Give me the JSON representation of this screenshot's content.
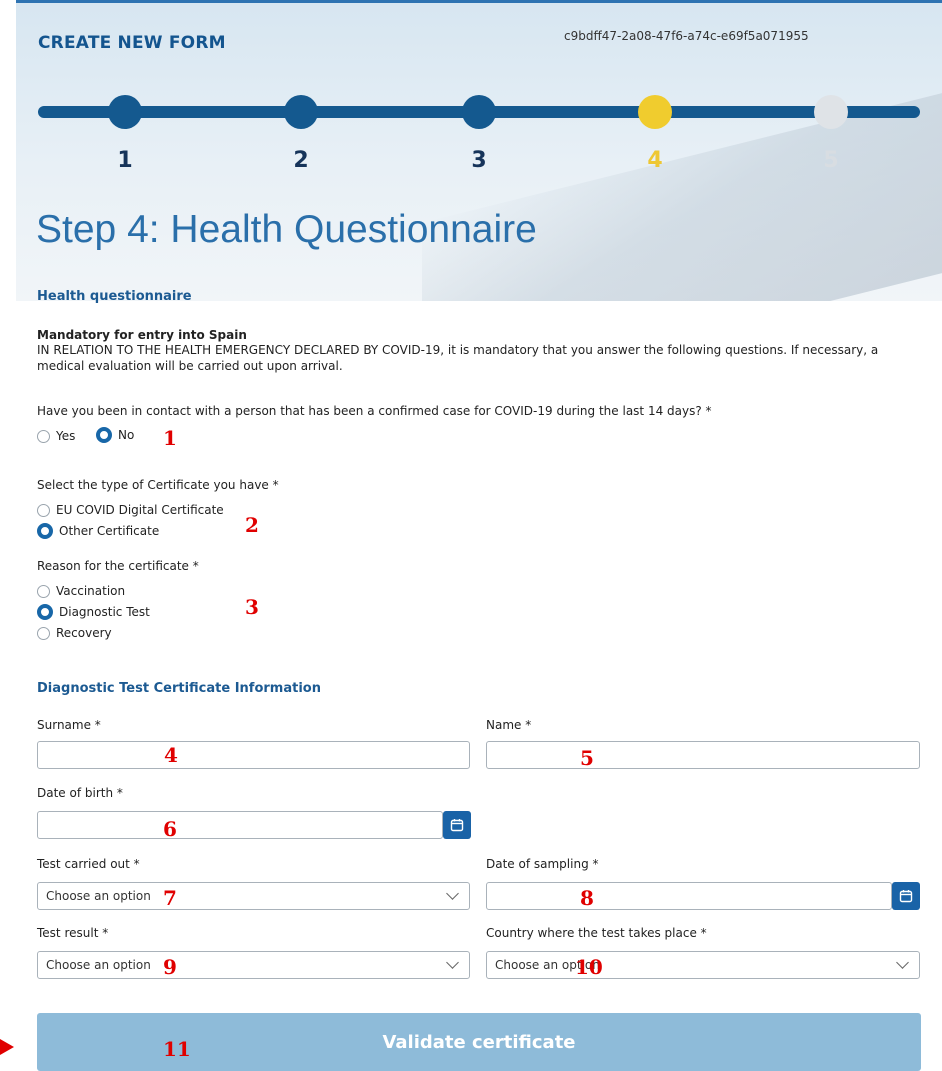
{
  "header": {
    "title": "CREATE NEW FORM",
    "form_id": "c9bdff47-2a08-47f6-a74c-e69f5a071955",
    "steps": [
      "1",
      "2",
      "3",
      "4",
      "5"
    ],
    "current_step": 4,
    "page_title": "Step 4: Health Questionnaire"
  },
  "questionnaire": {
    "section_title": "Health questionnaire",
    "mandatory_title": "Mandatory for entry into Spain",
    "intro_text": "IN RELATION TO THE HEALTH EMERGENCY DECLARED BY COVID-19, it is mandatory that you answer the following questions. If necessary, a medical evaluation will be carried out upon arrival.",
    "contact_question": "Have you been in contact with a person that has been a confirmed case for COVID-19 during the last 14 days? *",
    "contact_options": [
      "Yes",
      "No"
    ],
    "contact_selected": "No",
    "certificate_question": "Select the type of Certificate you have *",
    "certificate_options": [
      "EU COVID Digital Certificate",
      "Other Certificate"
    ],
    "certificate_selected": "Other Certificate",
    "reason_question": "Reason for the certificate *",
    "reason_options": [
      "Vaccination",
      "Diagnostic Test",
      "Recovery"
    ],
    "reason_selected": "Diagnostic Test"
  },
  "diagnostic": {
    "section_title": "Diagnostic Test Certificate Information",
    "surname_label": "Surname *",
    "surname_value": "",
    "name_label": "Name *",
    "name_value": "",
    "dob_label": "Date of birth *",
    "dob_value": "",
    "test_label": "Test carried out *",
    "test_value": "Choose an option",
    "sampling_label": "Date of sampling *",
    "sampling_value": "",
    "result_label": "Test result *",
    "result_value": "Choose an option",
    "country_label": "Country where the test takes place *",
    "country_value": "Choose an option"
  },
  "validate_label": "Validate certificate",
  "annotations": [
    "1",
    "2",
    "3",
    "4",
    "5",
    "6",
    "7",
    "8",
    "9",
    "10",
    "11"
  ],
  "colors": {
    "primary": "#1867a8",
    "step_active": "#f0cc2e",
    "step_pending": "#dfe3e7",
    "button_disabled": "#8ebbd9",
    "annotation": "#e00000"
  },
  "icons": [
    "calendar-icon",
    "chevron-down-icon",
    "arrow-right-icon"
  ]
}
